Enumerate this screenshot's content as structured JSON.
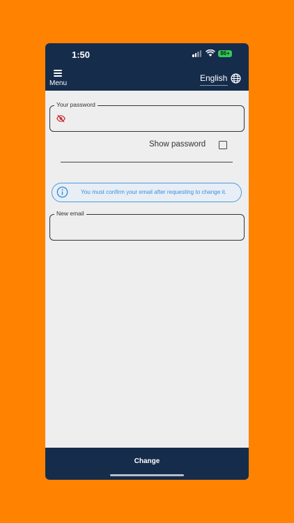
{
  "status_bar": {
    "time": "1:50",
    "battery": "86+"
  },
  "app_bar": {
    "menu_label": "Menu",
    "language_label": "English"
  },
  "form": {
    "password_label": "Your password",
    "password_value": "",
    "show_password_label": "Show password",
    "show_password_checked": false,
    "info_text": "You must confirm your email after requesting to change it.",
    "new_email_label": "New email",
    "new_email_value": ""
  },
  "bottom_bar": {
    "change_label": "Change"
  },
  "colors": {
    "background": "#FF8200",
    "navy": "#152C4B",
    "content_bg": "#EEEEEE",
    "info_blue": "#3B8FD9",
    "eye_icon_red": "#C62828",
    "battery_green": "#34C759"
  },
  "icons": {
    "menu": "menu-icon",
    "language": "globe-icon",
    "password_visibility": "eye-off-icon",
    "info": "info-icon"
  }
}
